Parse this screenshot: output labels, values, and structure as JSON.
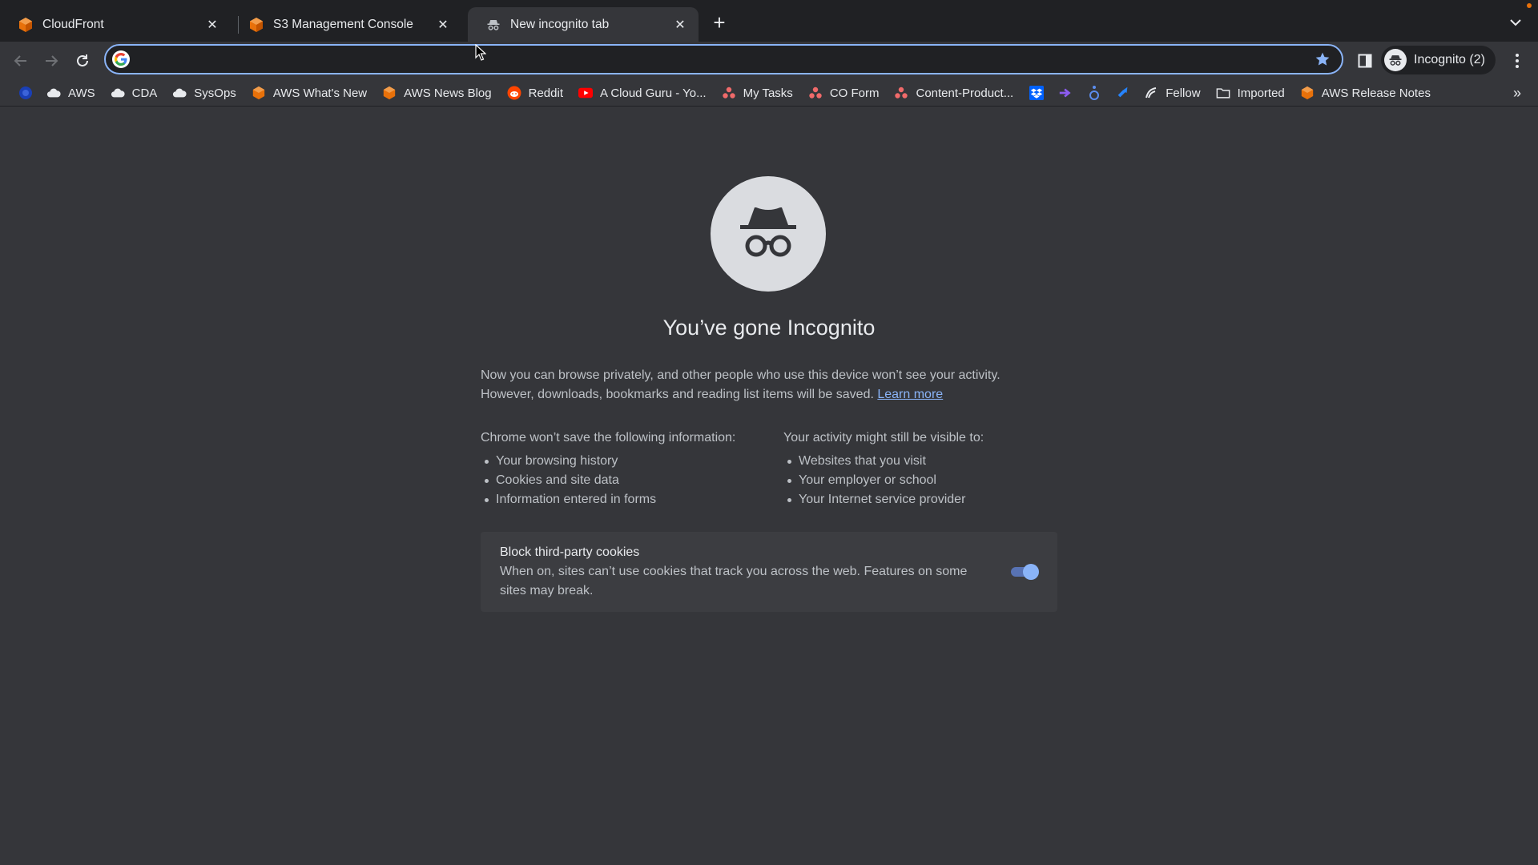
{
  "tabs": [
    {
      "title": "CloudFront",
      "favicon": "aws-cube-icon"
    },
    {
      "title": "S3 Management Console",
      "favicon": "aws-cube-icon"
    },
    {
      "title": "New incognito tab",
      "favicon": "incognito-icon",
      "active": true
    }
  ],
  "toolbar": {
    "omnibox_value": "",
    "profile_label": "Incognito (2)"
  },
  "bookmarks": [
    {
      "label": "",
      "icon": "blue-circle-icon"
    },
    {
      "label": "AWS",
      "icon": "cloud-icon"
    },
    {
      "label": "CDA",
      "icon": "cloud-icon"
    },
    {
      "label": "SysOps",
      "icon": "cloud-icon"
    },
    {
      "label": "AWS What's New",
      "icon": "aws-cube-icon"
    },
    {
      "label": "AWS News Blog",
      "icon": "aws-cube-icon"
    },
    {
      "label": "Reddit",
      "icon": "reddit-icon"
    },
    {
      "label": "A Cloud Guru - Yo...",
      "icon": "youtube-icon"
    },
    {
      "label": "My Tasks",
      "icon": "asana-icon"
    },
    {
      "label": "CO Form",
      "icon": "asana-icon"
    },
    {
      "label": "Content-Product...",
      "icon": "asana-icon"
    },
    {
      "label": "",
      "icon": "dropbox-icon"
    },
    {
      "label": "",
      "icon": "purple-arrow-icon"
    },
    {
      "label": "",
      "icon": "accessibility-icon"
    },
    {
      "label": "",
      "icon": "jira-icon"
    },
    {
      "label": "Fellow",
      "icon": "fellow-icon"
    },
    {
      "label": "Imported",
      "icon": "folder-icon"
    },
    {
      "label": "AWS Release Notes",
      "icon": "aws-cube-icon"
    }
  ],
  "page": {
    "heading": "You’ve gone Incognito",
    "intro_line1": "Now you can browse privately, and other people who use this device won’t see your activity.",
    "intro_line2": "However, downloads, bookmarks and reading list items will be saved.",
    "learn_more": "Learn more",
    "left_title": "Chrome won’t save the following information:",
    "left_items": [
      "Your browsing history",
      "Cookies and site data",
      "Information entered in forms"
    ],
    "right_title": "Your activity might still be visible to:",
    "right_items": [
      "Websites that you visit",
      "Your employer or school",
      "Your Internet service provider"
    ],
    "cookie_title": "Block third-party cookies",
    "cookie_desc": "When on, sites can’t use cookies that track you across the web. Features on some sites may break.",
    "cookie_toggle_on": true
  },
  "colors": {
    "accent": "#8ab4f8",
    "tabstrip_bg": "#202124",
    "page_bg": "#35363a",
    "aws_orange": "#e8710a"
  }
}
